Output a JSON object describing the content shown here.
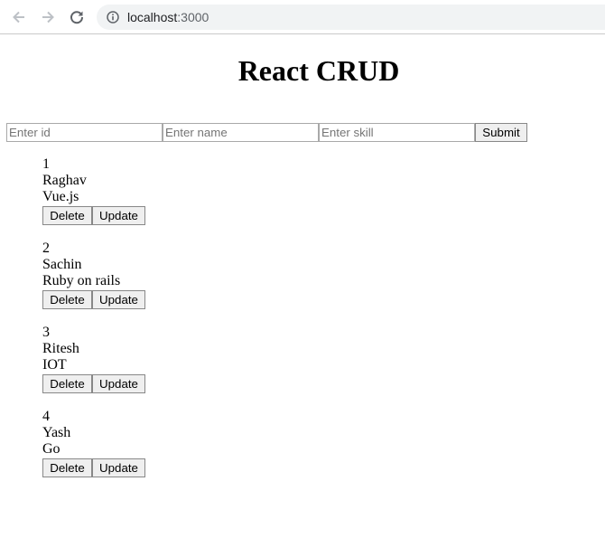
{
  "browser": {
    "url_host": "localhost",
    "url_port": ":3000"
  },
  "page": {
    "title": "React CRUD"
  },
  "form": {
    "id_placeholder": "Enter id",
    "name_placeholder": "Enter name",
    "skill_placeholder": "Enter skill",
    "submit_label": "Submit"
  },
  "records": [
    {
      "id": "1",
      "name": "Raghav",
      "skill": "Vue.js",
      "delete_label": "Delete",
      "update_label": "Update"
    },
    {
      "id": "2",
      "name": "Sachin",
      "skill": "Ruby on rails",
      "delete_label": "Delete",
      "update_label": "Update"
    },
    {
      "id": "3",
      "name": "Ritesh",
      "skill": "IOT",
      "delete_label": "Delete",
      "update_label": "Update"
    },
    {
      "id": "4",
      "name": "Yash",
      "skill": "Go",
      "delete_label": "Delete",
      "update_label": "Update"
    }
  ],
  "icons": {
    "back": "back-arrow-icon",
    "forward": "forward-arrow-icon",
    "reload": "reload-icon",
    "info": "info-icon"
  }
}
